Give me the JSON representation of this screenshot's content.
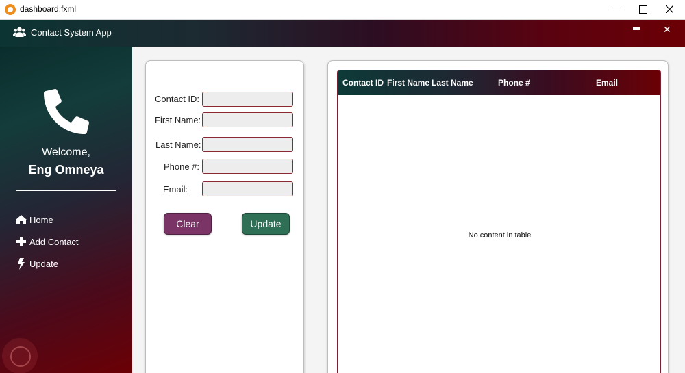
{
  "window": {
    "title": "dashboard.fxml"
  },
  "header": {
    "title": "Contact System App"
  },
  "sidebar": {
    "welcome": "Welcome,",
    "username": "Eng Omneya",
    "items": [
      {
        "label": "Home",
        "icon": "home-icon"
      },
      {
        "label": "Add Contact",
        "icon": "plus-icon"
      },
      {
        "label": "Update",
        "icon": "lightning-icon"
      }
    ]
  },
  "form": {
    "fields": [
      {
        "label": "Contact ID:",
        "value": ""
      },
      {
        "label": "First Name:",
        "value": ""
      },
      {
        "label": "Last Name:",
        "value": ""
      },
      {
        "label": "Phone #:",
        "value": ""
      },
      {
        "label": "Email:",
        "value": ""
      }
    ],
    "clear_label": "Clear",
    "update_label": "Update"
  },
  "table": {
    "columns": [
      "Contact ID",
      "First Name",
      "Last Name",
      "Phone #",
      "Email"
    ],
    "rows": [],
    "empty_message": "No content in table"
  },
  "colors": {
    "accent_dark_teal": "#0c3432",
    "accent_dark_red": "#6b0005",
    "clear_button": "#7a3466",
    "update_button": "#2f6f55"
  }
}
